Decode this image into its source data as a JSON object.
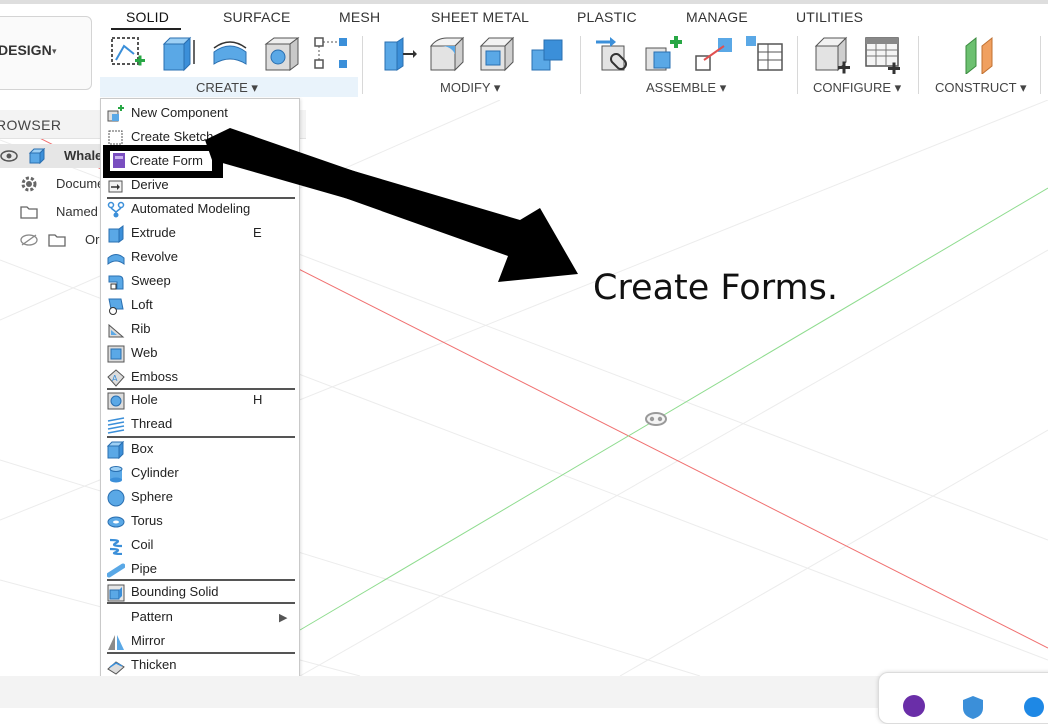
{
  "tabs": {
    "solid": "SOLID",
    "surface": "SURFACE",
    "mesh": "MESH",
    "sheet_metal": "SHEET METAL",
    "plastic": "PLASTIC",
    "manage": "MANAGE",
    "utilities": "UTILITIES"
  },
  "workspace": {
    "label": "DESIGN",
    "caret": "▾"
  },
  "groups": {
    "create": "CREATE ▾",
    "modify": "MODIFY ▾",
    "assemble": "ASSEMBLE ▾",
    "configure": "CONFIGURE ▾",
    "construct": "CONSTRUCT ▾"
  },
  "browser": {
    "title": "ROWSER",
    "rows": [
      "Whale",
      "Docume",
      "Named",
      "Or"
    ]
  },
  "menu": {
    "new_component": "New Component",
    "create_sketch": "Create Sketch",
    "create_form": "Create Form",
    "derive": "Derive",
    "automated_modeling": "Automated Modeling",
    "extrude": "Extrude",
    "extrude_key": "E",
    "revolve": "Revolve",
    "sweep": "Sweep",
    "loft": "Loft",
    "rib": "Rib",
    "web": "Web",
    "emboss": "Emboss",
    "hole": "Hole",
    "hole_key": "H",
    "thread": "Thread",
    "box": "Box",
    "cylinder": "Cylinder",
    "sphere": "Sphere",
    "torus": "Torus",
    "coil": "Coil",
    "pipe": "Pipe",
    "bounding_solid": "Bounding Solid",
    "pattern": "Pattern",
    "mirror": "Mirror",
    "thicken": "Thicken"
  },
  "annotation": "Create Forms.",
  "colors": {
    "accent_blue": "#3b8fd9",
    "icon_blue": "#5aa8e6",
    "add_green": "#28a745",
    "x_axis": "#f07070",
    "y_axis": "#8fdc8f",
    "highlight": "#000000"
  }
}
